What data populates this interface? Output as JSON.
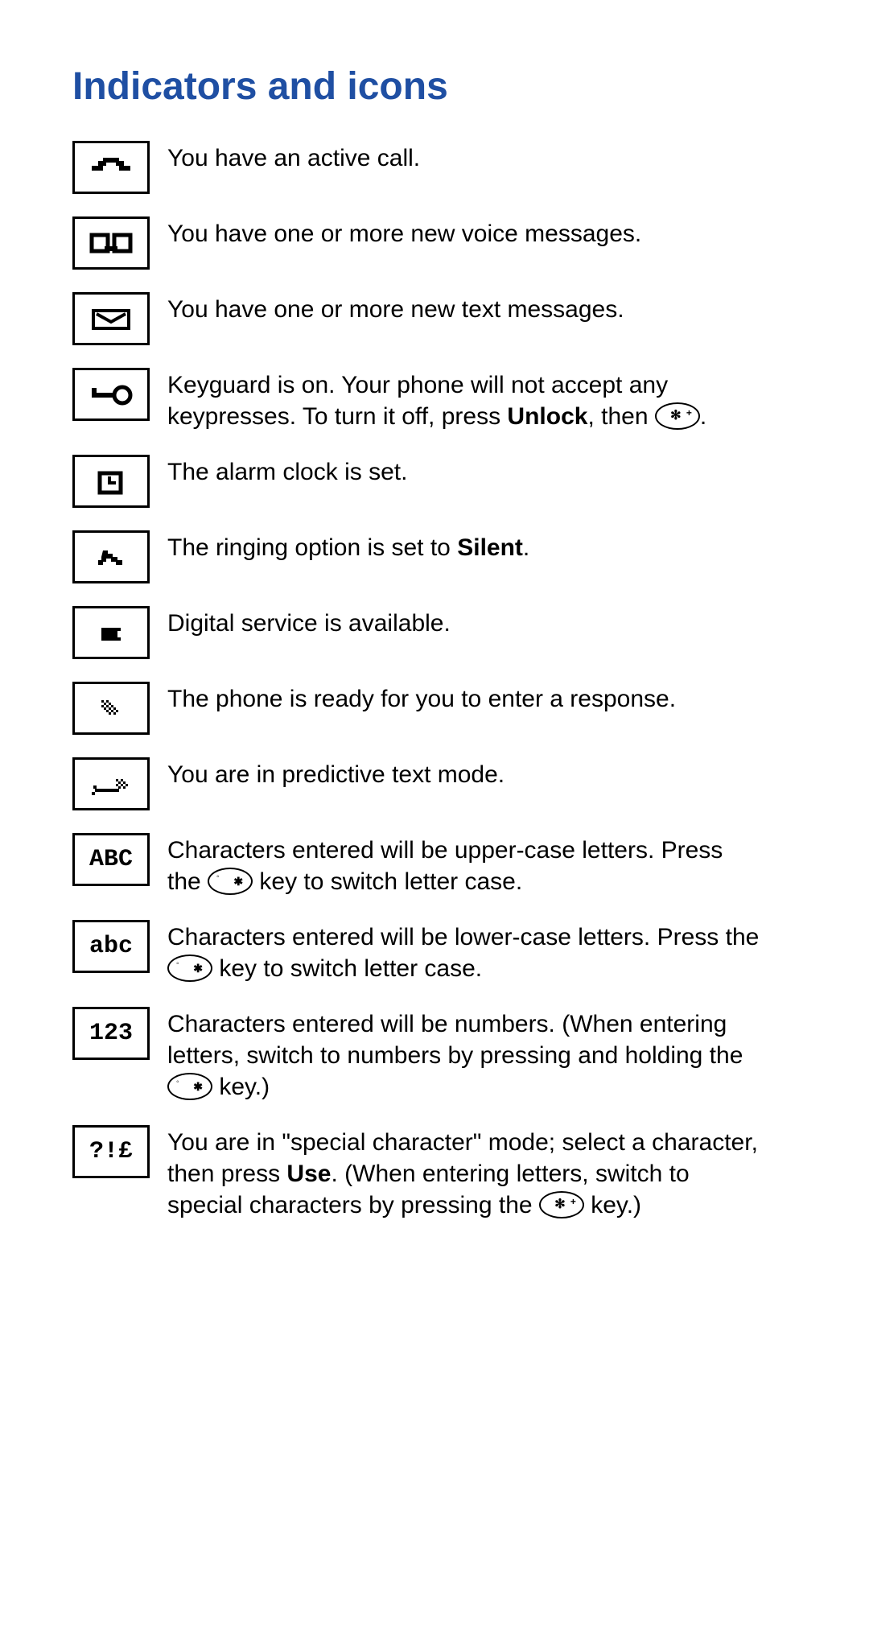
{
  "title": "Indicators and icons",
  "rows": [
    {
      "icon_name": "active-call-icon",
      "desc_parts": [
        "You have an active call."
      ]
    },
    {
      "icon_name": "voicemail-icon",
      "desc_parts": [
        "You have one or more new voice messages."
      ]
    },
    {
      "icon_name": "text-message-icon",
      "desc_parts": [
        "You have one or more new text messages."
      ]
    },
    {
      "icon_name": "keyguard-icon",
      "desc_parts": [
        "Keyguard is on. Your phone will not accept any keypresses. To turn it off, press ",
        {
          "b": "Unlock"
        },
        ", then ",
        {
          "key": "star"
        },
        "."
      ]
    },
    {
      "icon_name": "alarm-icon",
      "desc_parts": [
        "The alarm clock is set."
      ]
    },
    {
      "icon_name": "silent-icon",
      "desc_parts": [
        "The ringing option is set to ",
        {
          "b": "Silent"
        },
        "."
      ]
    },
    {
      "icon_name": "digital-service-icon",
      "desc_parts": [
        "Digital service is available."
      ]
    },
    {
      "icon_name": "response-icon",
      "desc_parts": [
        "The phone is ready for you to enter a response."
      ]
    },
    {
      "icon_name": "predictive-text-icon",
      "desc_parts": [
        "You are in predictive text mode."
      ]
    },
    {
      "icon_name": "uppercase-icon",
      "icon_text": "ABC",
      "desc_parts": [
        "Characters entered will be upper-case letters. Press the ",
        {
          "key": "hash"
        },
        " key to switch letter case."
      ]
    },
    {
      "icon_name": "lowercase-icon",
      "icon_text": "abc",
      "desc_parts": [
        "Characters entered will be lower-case letters. Press the ",
        {
          "key": "hash"
        },
        " key to switch letter case."
      ]
    },
    {
      "icon_name": "numbers-icon",
      "icon_text": "123",
      "desc_parts": [
        "Characters entered will be numbers. (When entering letters, switch to numbers by pressing and holding the ",
        {
          "key": "hash"
        },
        " key.)"
      ]
    },
    {
      "icon_name": "special-char-icon",
      "icon_text": "?!£",
      "desc_parts": [
        "You are in \"special character\" mode; select a character, then press ",
        {
          "b": "Use"
        },
        ". (When entering letters, switch to special characters by pressing the ",
        {
          "key": "star"
        },
        " key.)"
      ]
    }
  ]
}
